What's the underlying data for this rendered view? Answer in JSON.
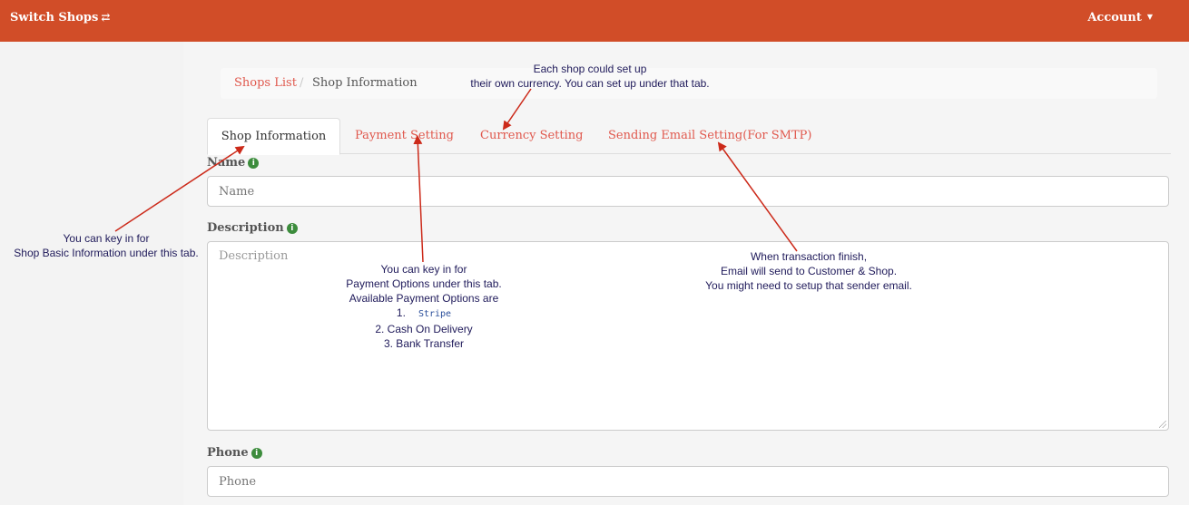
{
  "navbar": {
    "brand": "Switch Shops",
    "brand_icon": "swap-arrows-icon",
    "account": "Account",
    "color": "#d14d28"
  },
  "breadcrumb": {
    "link": "Shops List",
    "separator": "/",
    "current": "Shop Information"
  },
  "tabs": [
    {
      "label": "Shop Information",
      "active": true
    },
    {
      "label": "Payment Setting",
      "active": false
    },
    {
      "label": "Currency Setting",
      "active": false
    },
    {
      "label": "Sending Email Setting(For SMTP)",
      "active": false
    }
  ],
  "form": {
    "name": {
      "label": "Name",
      "placeholder": "Name"
    },
    "description": {
      "label": "Description",
      "placeholder": "Description"
    },
    "phone": {
      "label": "Phone",
      "placeholder": "Phone"
    }
  },
  "annotations": {
    "currency": [
      "Each shop could set up",
      "their own currency. You can set up under that tab."
    ],
    "shop_info": [
      "You can key in for",
      "Shop Basic Information under this tab."
    ],
    "payment": {
      "lines": [
        "You can key in for",
        "Payment Options under this tab.",
        "Available Payment Options are"
      ],
      "option1_prefix": "1.",
      "option1": "Stripe",
      "option2": "2. Cash On Delivery",
      "option3": "3. Bank Transfer"
    },
    "email": [
      "When transaction finish,",
      "Email will send to Customer & Shop.",
      "You might need to setup that sender email."
    ],
    "arrow_color": "#cc2a1a"
  }
}
